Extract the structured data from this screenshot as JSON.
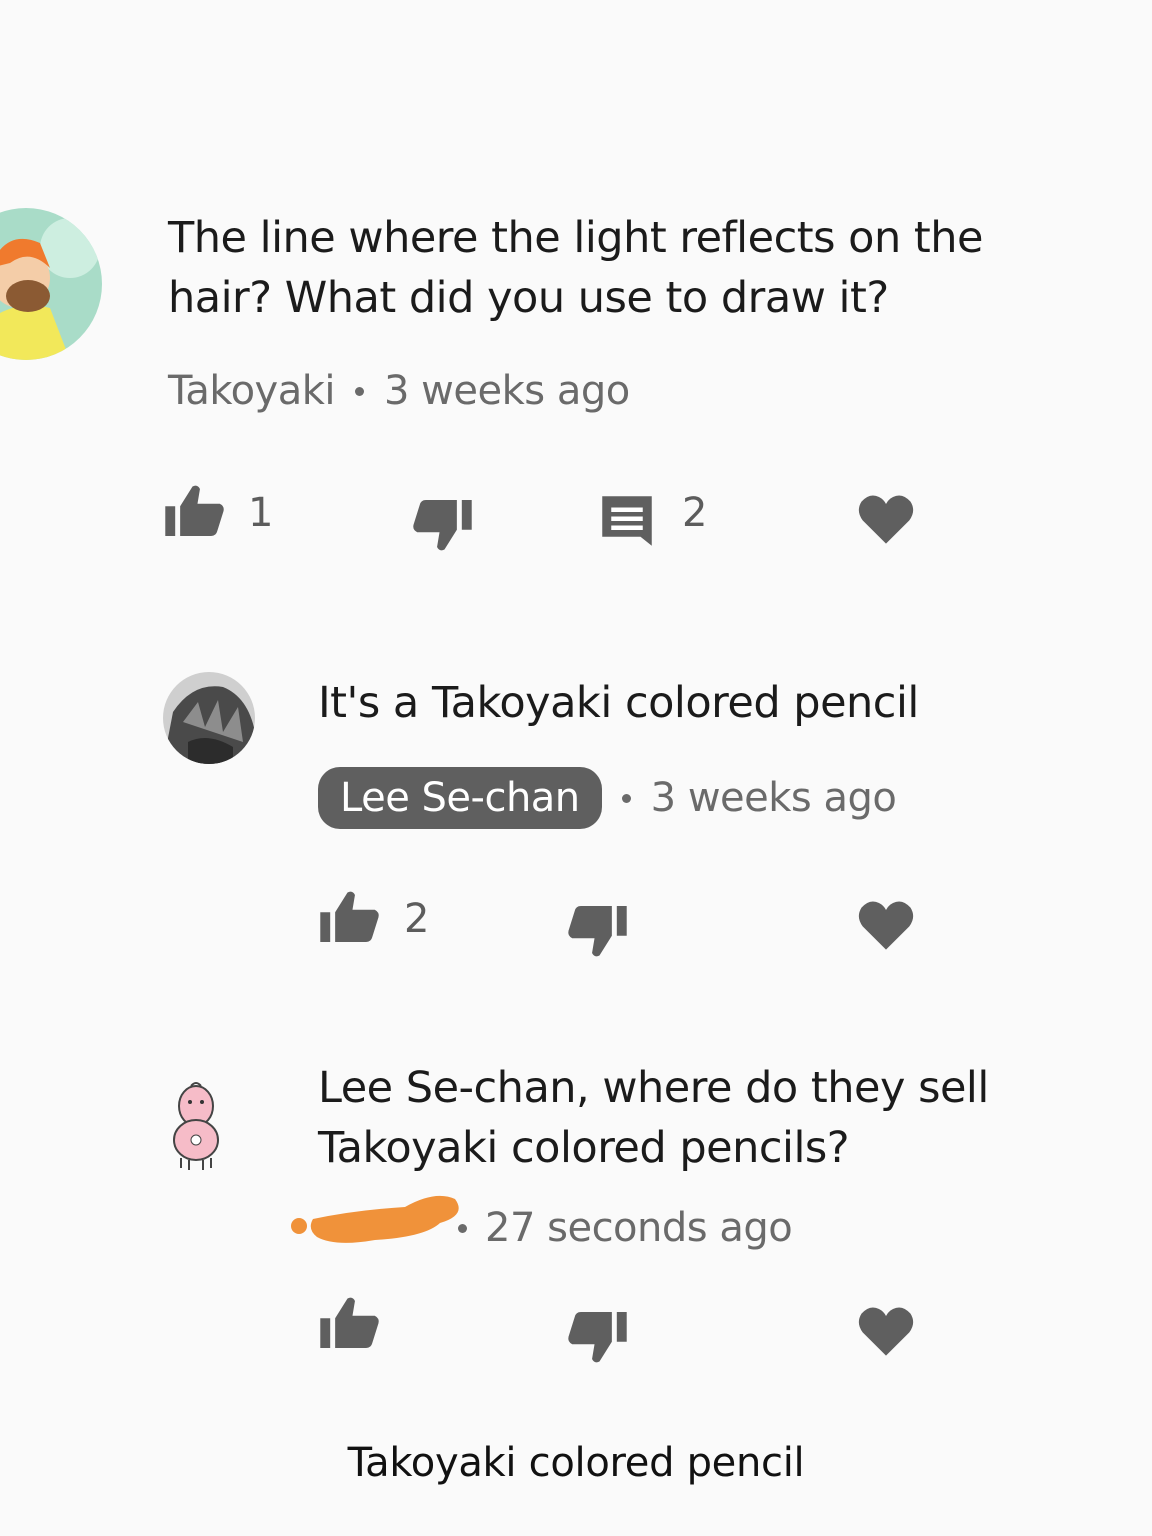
{
  "comments": [
    {
      "text": "The line where the light reflects on the hair? What did you use to draw it?",
      "author": "Takoyaki",
      "time": "3 weeks ago",
      "likes": "1",
      "replies": "2"
    },
    {
      "text": "It's a Takoyaki colored pencil",
      "author": "Lee Se-chan",
      "time": "3 weeks ago",
      "likes": "2"
    },
    {
      "text": "Lee Se-chan, where do they sell Takoyaki colored pencils?",
      "time": "27 seconds ago"
    }
  ],
  "caption": "Takoyaki colored pencil",
  "colors": {
    "icon": "#5f5f5f",
    "redaction": "#f0923a",
    "chip": "#5f5f5f"
  }
}
